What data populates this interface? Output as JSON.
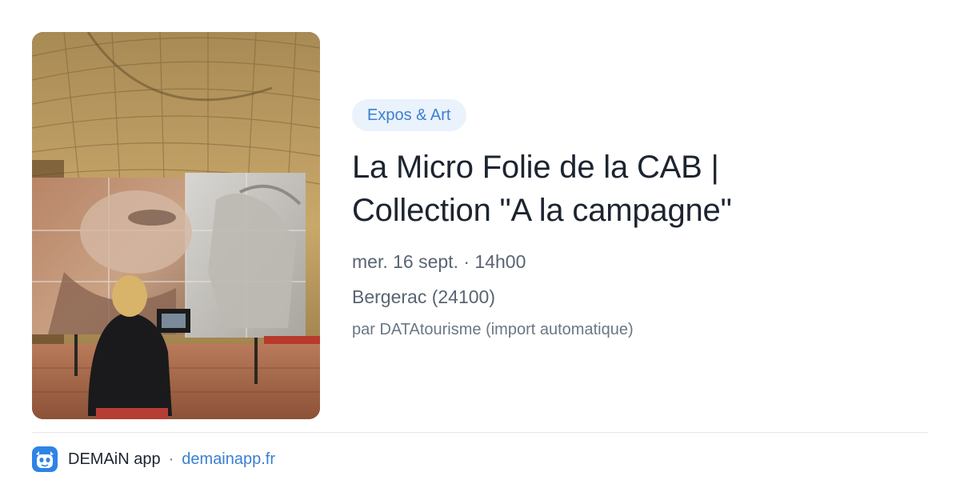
{
  "event": {
    "category": "Expos & Art",
    "title_line1": "La Micro Folie de la CAB |",
    "title_line2": "Collection \"A la campagne\"",
    "datetime": "mer. 16 sept. · 14h00",
    "location": "Bergerac (24100)",
    "author": "par DATAtourisme (import automatique)",
    "image_icon": "exhibition-photo"
  },
  "footer": {
    "app_icon": "demain-app-icon",
    "app_name": "DEMAiN app",
    "separator": "·",
    "domain": "demainapp.fr"
  },
  "colors": {
    "accent": "#3a7fd0",
    "badge_bg": "#eaf2fc",
    "title": "#1d2430",
    "meta": "#5a6472",
    "divider": "#e1e7ec"
  }
}
